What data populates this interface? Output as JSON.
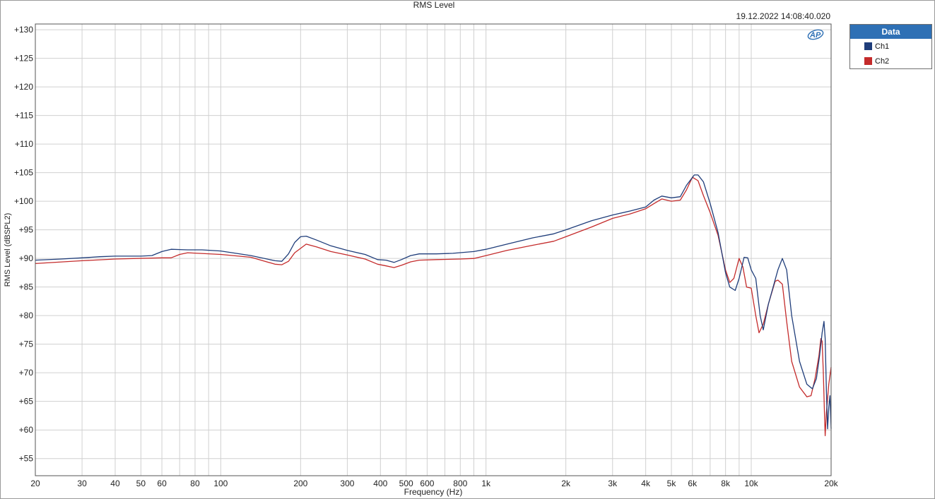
{
  "chart_data": {
    "type": "line",
    "title": "RMS Level",
    "timestamp": "19.12.2022 14:08:40.020",
    "xlabel": "Frequency (Hz)",
    "ylabel": "RMS Level (dBSPL2)",
    "x_scale": "log",
    "xlim": [
      20,
      20000
    ],
    "ylim": [
      52,
      131
    ],
    "grid": true,
    "legend_title": "Data",
    "legend_position": "right",
    "x_ticks": [
      {
        "value": 20,
        "label": "20"
      },
      {
        "value": 30,
        "label": "30"
      },
      {
        "value": 40,
        "label": "40"
      },
      {
        "value": 50,
        "label": "50"
      },
      {
        "value": 60,
        "label": "60"
      },
      {
        "value": 80,
        "label": "80"
      },
      {
        "value": 100,
        "label": "100"
      },
      {
        "value": 200,
        "label": "200"
      },
      {
        "value": 300,
        "label": "300"
      },
      {
        "value": 400,
        "label": "400"
      },
      {
        "value": 500,
        "label": "500"
      },
      {
        "value": 600,
        "label": "600"
      },
      {
        "value": 800,
        "label": "800"
      },
      {
        "value": 1000,
        "label": "1k"
      },
      {
        "value": 2000,
        "label": "2k"
      },
      {
        "value": 3000,
        "label": "3k"
      },
      {
        "value": 4000,
        "label": "4k"
      },
      {
        "value": 5000,
        "label": "5k"
      },
      {
        "value": 6000,
        "label": "6k"
      },
      {
        "value": 8000,
        "label": "8k"
      },
      {
        "value": 10000,
        "label": "10k"
      },
      {
        "value": 20000,
        "label": "20k"
      }
    ],
    "x_grid": [
      20,
      30,
      40,
      50,
      60,
      70,
      80,
      90,
      100,
      200,
      300,
      400,
      500,
      600,
      700,
      800,
      900,
      1000,
      2000,
      3000,
      4000,
      5000,
      6000,
      7000,
      8000,
      9000,
      10000,
      20000
    ],
    "y_ticks": [
      {
        "value": 130,
        "label": "+130"
      },
      {
        "value": 125,
        "label": "+125"
      },
      {
        "value": 120,
        "label": "+120"
      },
      {
        "value": 115,
        "label": "+115"
      },
      {
        "value": 110,
        "label": "+110"
      },
      {
        "value": 105,
        "label": "+105"
      },
      {
        "value": 100,
        "label": "+100"
      },
      {
        "value": 95,
        "label": "+95"
      },
      {
        "value": 90,
        "label": "+90"
      },
      {
        "value": 85,
        "label": "+85"
      },
      {
        "value": 80,
        "label": "+80"
      },
      {
        "value": 75,
        "label": "+75"
      },
      {
        "value": 70,
        "label": "+70"
      },
      {
        "value": 65,
        "label": "+65"
      },
      {
        "value": 60,
        "label": "+60"
      },
      {
        "value": 55,
        "label": "+55"
      }
    ],
    "series": [
      {
        "name": "Ch1",
        "color": "#1f3d7a",
        "points": [
          [
            20,
            89.7
          ],
          [
            25,
            89.9
          ],
          [
            30,
            90.1
          ],
          [
            35,
            90.3
          ],
          [
            40,
            90.4
          ],
          [
            50,
            90.4
          ],
          [
            55,
            90.5
          ],
          [
            60,
            91.2
          ],
          [
            65,
            91.6
          ],
          [
            75,
            91.5
          ],
          [
            85,
            91.5
          ],
          [
            100,
            91.3
          ],
          [
            130,
            90.5
          ],
          [
            160,
            89.6
          ],
          [
            170,
            89.5
          ],
          [
            180,
            90.8
          ],
          [
            190,
            92.8
          ],
          [
            200,
            93.8
          ],
          [
            210,
            93.9
          ],
          [
            230,
            93.2
          ],
          [
            260,
            92.2
          ],
          [
            300,
            91.4
          ],
          [
            350,
            90.7
          ],
          [
            390,
            89.8
          ],
          [
            420,
            89.7
          ],
          [
            450,
            89.3
          ],
          [
            480,
            89.8
          ],
          [
            520,
            90.5
          ],
          [
            560,
            90.8
          ],
          [
            650,
            90.8
          ],
          [
            750,
            90.9
          ],
          [
            900,
            91.2
          ],
          [
            1000,
            91.6
          ],
          [
            1200,
            92.5
          ],
          [
            1500,
            93.6
          ],
          [
            1800,
            94.3
          ],
          [
            2000,
            95.0
          ],
          [
            2500,
            96.6
          ],
          [
            3000,
            97.6
          ],
          [
            3500,
            98.3
          ],
          [
            4000,
            99.0
          ],
          [
            4300,
            100.2
          ],
          [
            4600,
            100.9
          ],
          [
            5000,
            100.6
          ],
          [
            5400,
            100.8
          ],
          [
            5700,
            102.8
          ],
          [
            6100,
            104.6
          ],
          [
            6300,
            104.6
          ],
          [
            6600,
            103.4
          ],
          [
            7000,
            99.6
          ],
          [
            7500,
            94.5
          ],
          [
            8000,
            87.5
          ],
          [
            8300,
            85.0
          ],
          [
            8700,
            84.4
          ],
          [
            9000,
            86.5
          ],
          [
            9400,
            90.2
          ],
          [
            9700,
            90.1
          ],
          [
            10000,
            88.0
          ],
          [
            10400,
            86.5
          ],
          [
            10800,
            80.0
          ],
          [
            11100,
            77.5
          ],
          [
            11600,
            82.0
          ],
          [
            12600,
            88.0
          ],
          [
            13100,
            90.0
          ],
          [
            13600,
            88.0
          ],
          [
            14200,
            80.0
          ],
          [
            15200,
            72.0
          ],
          [
            16200,
            68.0
          ],
          [
            17000,
            67.2
          ],
          [
            17600,
            69.0
          ],
          [
            18100,
            73.0
          ],
          [
            18500,
            77.0
          ],
          [
            18800,
            79.0
          ],
          [
            19000,
            76.0
          ],
          [
            19200,
            67.0
          ],
          [
            19400,
            60.2
          ],
          [
            19600,
            64.0
          ],
          [
            19800,
            66.0
          ],
          [
            20000,
            60.2
          ]
        ]
      },
      {
        "name": "Ch2",
        "color": "#c42b2b",
        "points": [
          [
            20,
            89.1
          ],
          [
            30,
            89.6
          ],
          [
            40,
            89.9
          ],
          [
            60,
            90.1
          ],
          [
            65,
            90.1
          ],
          [
            70,
            90.7
          ],
          [
            75,
            91.0
          ],
          [
            100,
            90.7
          ],
          [
            130,
            90.2
          ],
          [
            160,
            89.0
          ],
          [
            170,
            88.9
          ],
          [
            180,
            89.5
          ],
          [
            190,
            91.0
          ],
          [
            210,
            92.5
          ],
          [
            230,
            92.0
          ],
          [
            260,
            91.2
          ],
          [
            300,
            90.6
          ],
          [
            350,
            89.9
          ],
          [
            390,
            89.0
          ],
          [
            420,
            88.7
          ],
          [
            450,
            88.4
          ],
          [
            480,
            88.8
          ],
          [
            520,
            89.4
          ],
          [
            560,
            89.7
          ],
          [
            650,
            89.8
          ],
          [
            800,
            89.9
          ],
          [
            900,
            90.0
          ],
          [
            1000,
            90.5
          ],
          [
            1200,
            91.4
          ],
          [
            1500,
            92.3
          ],
          [
            1800,
            93.0
          ],
          [
            2000,
            93.8
          ],
          [
            2500,
            95.5
          ],
          [
            3000,
            97.0
          ],
          [
            3500,
            97.8
          ],
          [
            4000,
            98.7
          ],
          [
            4300,
            99.6
          ],
          [
            4600,
            100.4
          ],
          [
            5000,
            100.0
          ],
          [
            5400,
            100.2
          ],
          [
            5700,
            102.0
          ],
          [
            6000,
            104.2
          ],
          [
            6300,
            103.6
          ],
          [
            6600,
            101.0
          ],
          [
            7000,
            98.0
          ],
          [
            7500,
            94.0
          ],
          [
            8000,
            88.0
          ],
          [
            8300,
            85.8
          ],
          [
            8600,
            86.5
          ],
          [
            9000,
            90.0
          ],
          [
            9300,
            88.5
          ],
          [
            9600,
            85.0
          ],
          [
            10000,
            84.8
          ],
          [
            10400,
            80.0
          ],
          [
            10700,
            77.0
          ],
          [
            11100,
            78.5
          ],
          [
            11600,
            82.0
          ],
          [
            12300,
            86.0
          ],
          [
            12600,
            86.2
          ],
          [
            13100,
            85.5
          ],
          [
            13600,
            79.0
          ],
          [
            14200,
            72.0
          ],
          [
            15200,
            67.5
          ],
          [
            16200,
            65.8
          ],
          [
            16800,
            66.0
          ],
          [
            17400,
            69.0
          ],
          [
            18000,
            73.0
          ],
          [
            18300,
            76.0
          ],
          [
            18500,
            75.5
          ],
          [
            18700,
            70.0
          ],
          [
            18900,
            62.0
          ],
          [
            19000,
            59.0
          ],
          [
            19200,
            63.0
          ],
          [
            19600,
            68.0
          ],
          [
            20000,
            71.0
          ]
        ]
      }
    ]
  }
}
